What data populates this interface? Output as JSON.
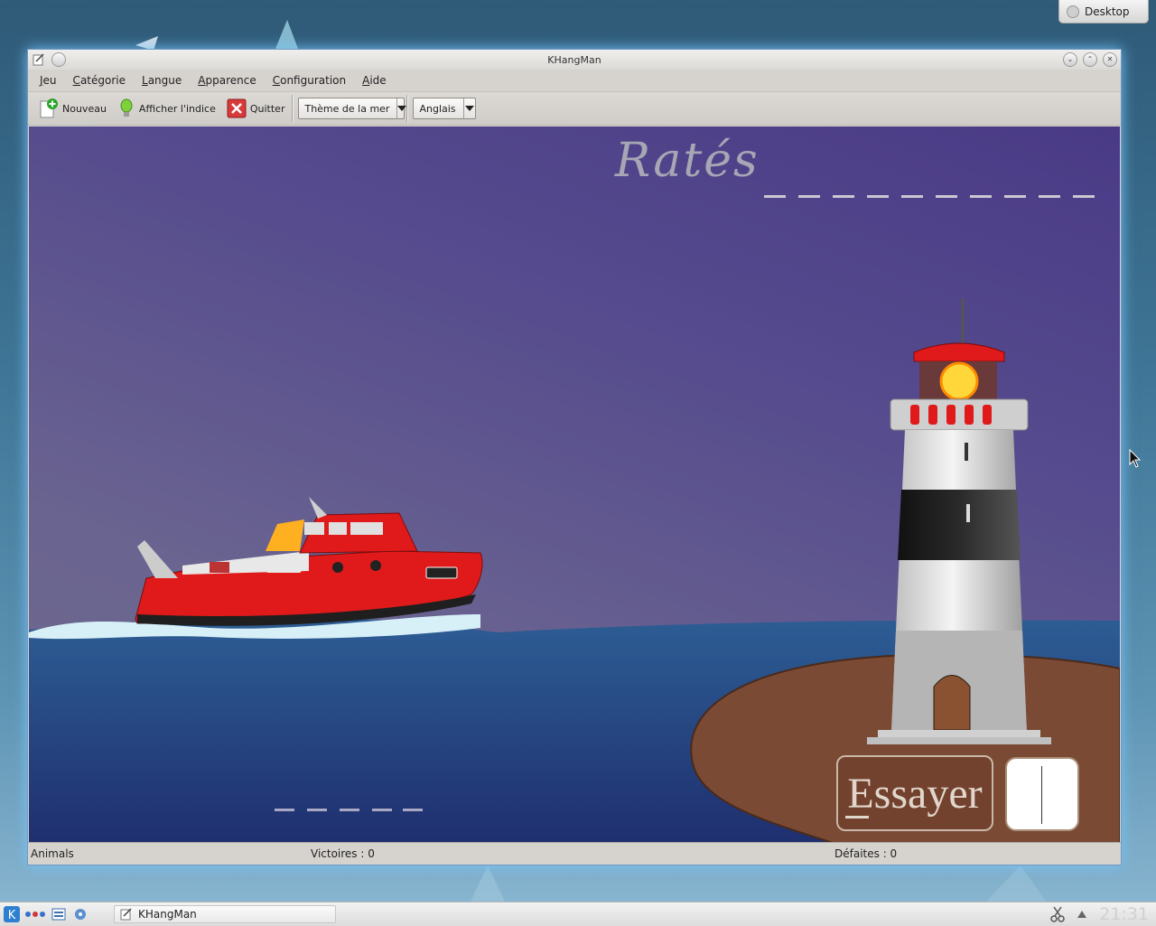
{
  "desktop": {
    "button_label": "Desktop"
  },
  "window": {
    "title": "KHangMan",
    "menu": [
      {
        "label": "Jeu",
        "ul": "J",
        "rest": "eu"
      },
      {
        "label": "Catégorie",
        "ul": "C",
        "rest": "atégorie"
      },
      {
        "label": "Langue",
        "ul": "L",
        "rest": "angue"
      },
      {
        "label": "Apparence",
        "ul": "A",
        "rest": "pparence"
      },
      {
        "label": "Configuration",
        "ul": "C",
        "rest": "onfiguration"
      },
      {
        "label": "Aide",
        "ul": "A",
        "rest": "ide"
      }
    ],
    "toolbar": {
      "new_label": "Nouveau",
      "hint_label": "Afficher l'indice",
      "quit_label": "Quitter",
      "theme_value": "Thème de la mer",
      "language_value": "Anglais"
    },
    "game": {
      "misses_label": "Ratés",
      "missed_letter_slots": 10,
      "word_letter_slots": 5,
      "try_button_label": "Essayer",
      "letter_input_value": ""
    },
    "statusbar": {
      "category": "Animals",
      "wins": "Victoires : 0",
      "losses": "Défaites : 0"
    }
  },
  "taskbar": {
    "task_label": "KHangMan",
    "clock": "21:31"
  },
  "colors": {
    "sky_top": "#4a3a86",
    "sea": "#2b4f8f",
    "island": "#7a4a35",
    "boat_red": "#e02020",
    "lighthouse_band": "#1e1e1e"
  }
}
